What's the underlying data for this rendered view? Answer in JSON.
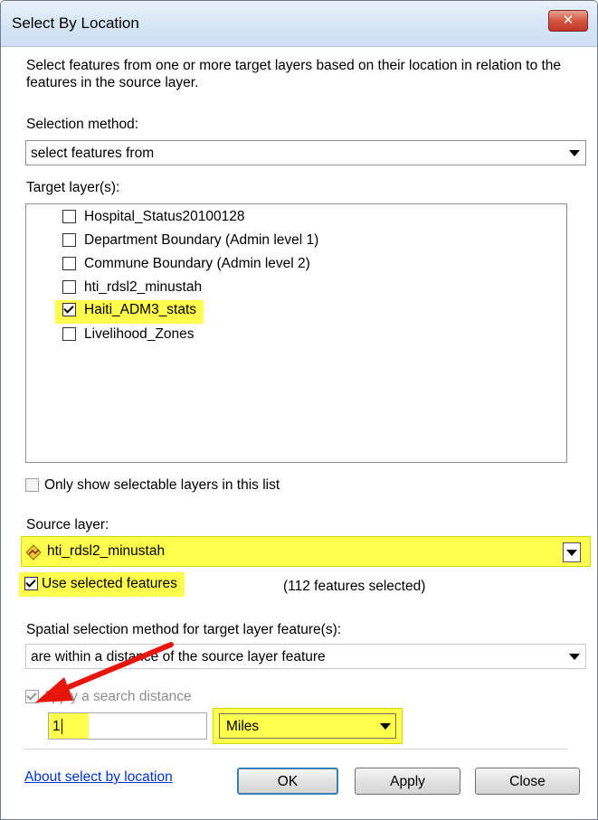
{
  "window": {
    "title": "Select By Location",
    "close_glyph": "✕"
  },
  "description": "Select features from one or more target layers based on their location in relation to the features in the source layer.",
  "selection_method": {
    "label": "Selection method:",
    "value": "select features from"
  },
  "target_layers": {
    "label": "Target layer(s):",
    "items": [
      {
        "label": "Hospital_Status20100128",
        "checked": false
      },
      {
        "label": "Department Boundary (Admin level 1)",
        "checked": false
      },
      {
        "label": "Commune Boundary (Admin level 2)",
        "checked": false
      },
      {
        "label": "hti_rdsl2_minustah",
        "checked": false
      },
      {
        "label": "Haiti_ADM3_stats",
        "checked": true
      },
      {
        "label": "Livelihood_Zones",
        "checked": false
      }
    ]
  },
  "only_selectable": {
    "label": "Only show selectable layers in this list",
    "checked": false
  },
  "source_layer": {
    "label": "Source layer:",
    "value": "hti_rdsl2_minustah",
    "icon": "line-layer-icon"
  },
  "use_selected": {
    "label": "Use selected features",
    "checked": true,
    "count_text": "(112 features selected)"
  },
  "spatial_method": {
    "label": "Spatial selection method for target layer feature(s):",
    "value": "are within a distance of the source layer feature"
  },
  "search_distance": {
    "label": "Apply a search distance",
    "checked": true,
    "disabled": true,
    "value": "1",
    "units": "Miles"
  },
  "footer": {
    "link": "About select by location",
    "ok": "OK",
    "apply": "Apply",
    "close": "Close"
  },
  "colors": {
    "highlight": "#ffff4d",
    "annotation_arrow": "#e8150c",
    "link": "#0033cc"
  }
}
